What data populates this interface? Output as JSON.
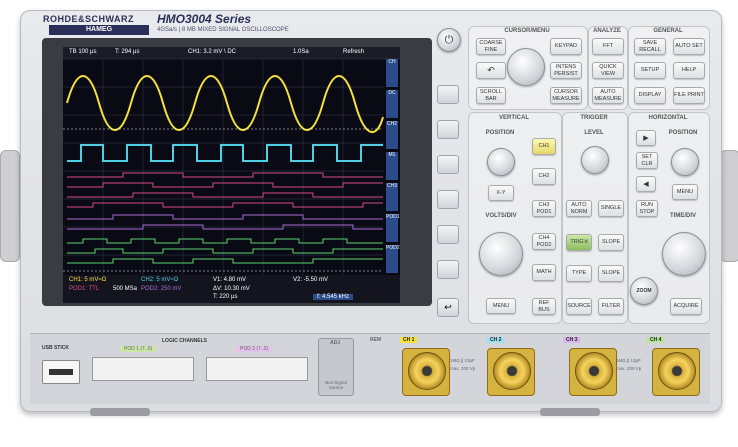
{
  "header": {
    "brand": "ROHDE&SCHWARZ",
    "brand_sub": "HAMEG",
    "model": "HMO3004 Series",
    "subtitle": "4GSa/s | 8 MB MIXED SIGNAL OSCILLOSCOPE"
  },
  "screen": {
    "timebase": "TB 100 µs",
    "trigger_time": "T: 294 µs",
    "trigger_channel": "CH1: 3.2 mV \\ DC",
    "sample_rate": "1.0Sa",
    "mode": "Refresh",
    "ch1_setting": "CH1: 5 mV≈Ω",
    "ch2_setting": "CH2: 5 mV≈Ω",
    "pod1_setting": "POD1: TTL",
    "memory": "500 MSa",
    "pod2_setting": "POD2: 250 mV",
    "v1": "V1: 4.80 mV",
    "v2": "V2: -5.50 mV",
    "dv": "ΔV: 10.30 mV",
    "t_delta": "T: 220 µs",
    "freq": "f: 4.545 kHz"
  },
  "sidebar_labels": [
    "CH",
    "DC",
    "CH2",
    "M1",
    "CH3",
    "POD1",
    "POD2",
    "ACQ"
  ],
  "panel": {
    "cursor_menu_title": "CURSOR/MENU",
    "analyze_title": "ANALYZE",
    "general_title": "GENERAL",
    "vertical_title": "VERTICAL",
    "trigger_title": "TRIGGER",
    "horizontal_title": "HORIZONTAL",
    "position_label": "POSITION",
    "level_label": "LEVEL",
    "volts_div_label": "VOLTS/DIV",
    "time_div_label": "TIME/DIV",
    "buttons": {
      "coarse_fine": "COARSE FINE",
      "keypad": "KEYPAD",
      "fft": "FFT",
      "save_recall": "SAVE RECALL",
      "autoset": "AUTO SET",
      "intens_persist": "INTENS PERSIST",
      "quick_view": "QUICK VIEW",
      "setup": "SETUP",
      "help": "HELP",
      "scroll_bar": "SCROLL BAR",
      "cursor_measure": "CURSOR MEASURE",
      "auto_measure": "AUTO MEASURE",
      "display": "DISPLAY",
      "file_print": "FILE PRINT",
      "ch1": "CH1",
      "ch2": "CH2",
      "ch3_pod1": "CH3 POD1",
      "ch4_pod2": "CH4 POD2",
      "math": "MATH",
      "xy": "X-Y",
      "auto_norm": "AUTO NORM",
      "single": "SINGLE",
      "trig_d": "TRIG'd",
      "slope_icon": "SLOPE",
      "type": "TYPE",
      "slope": "SLOPE",
      "source": "SOURCE",
      "filter": "FILTER",
      "menu_vertical": "MENU",
      "ref_bus": "REF BUS",
      "set_clr": "SET CLR",
      "menu_horizontal": "MENU",
      "run_stop": "RUN STOP",
      "acquire": "ACQUIRE",
      "zoom": "ZOOM"
    }
  },
  "front": {
    "usb_stick": "USB STICK",
    "logic_channels": "LOGIC CHANNELS",
    "pod1_label": "POD 1 (7..0)",
    "pod2_label": "POD 2 (7..0)",
    "adj": "ADJ",
    "bus_signal_source": "Bus Signal Source",
    "bnc_labels": [
      "CH 1",
      "CH 2",
      "CH 3",
      "CH 4"
    ],
    "impedance": "1MΩ || 13pF",
    "max_voltage": "max. 200 Vp",
    "rem": "REM"
  }
}
